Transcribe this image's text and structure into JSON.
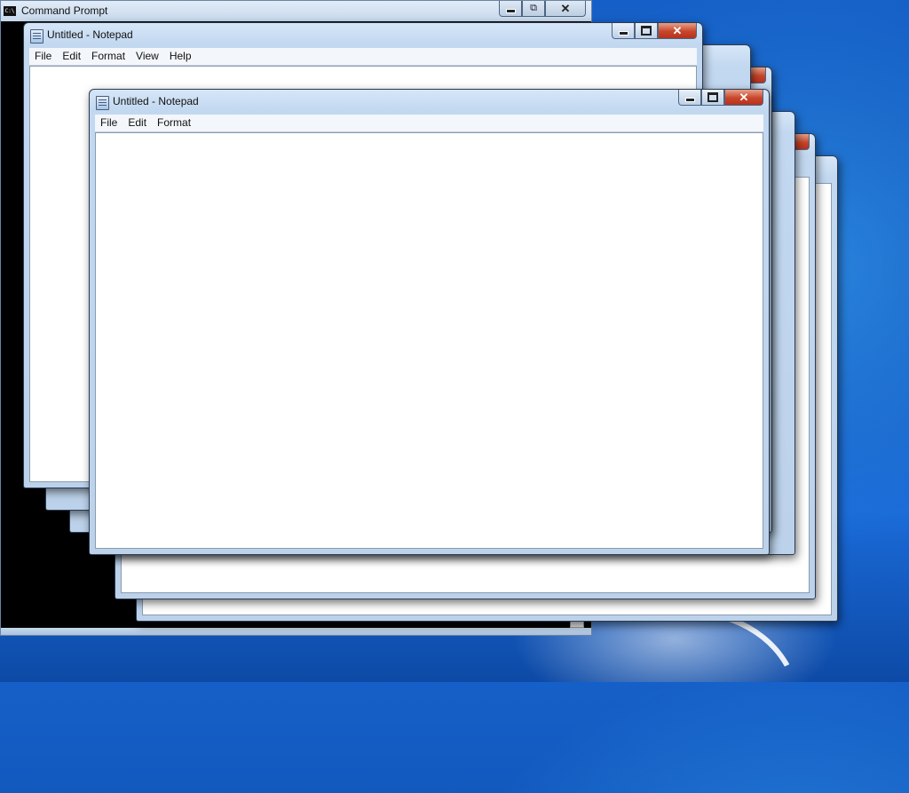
{
  "cmd": {
    "title": "Command Prompt",
    "icon": "cmd-icon",
    "icon_text": "C:\\",
    "minimize": "–",
    "restore": "⧉",
    "close": "✕",
    "scroll_down": "▼"
  },
  "notepad_back": {
    "title": "Untitled - Notepad",
    "menu": [
      "File",
      "Edit",
      "Format",
      "View",
      "Help"
    ]
  },
  "notepad_front": {
    "title": "Untitled - Notepad",
    "menu": [
      "File",
      "Edit",
      "Format"
    ]
  },
  "close_glyph": "✕",
  "desktop": {
    "accent": "#1560c8"
  }
}
